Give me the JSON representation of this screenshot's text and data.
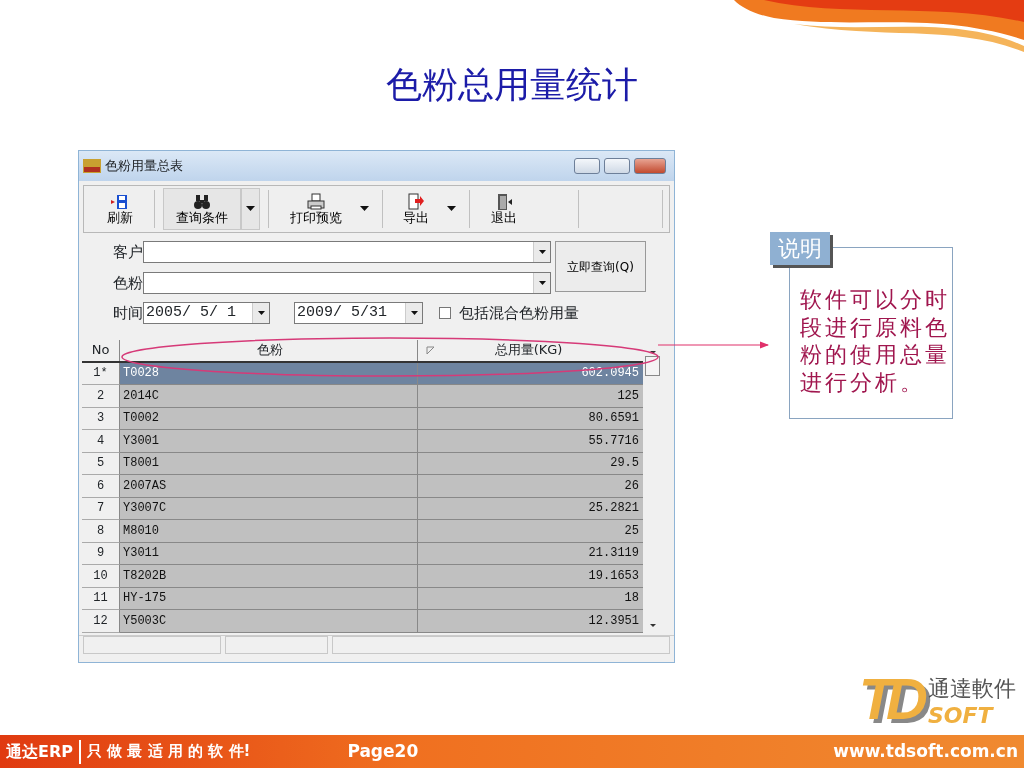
{
  "slide": {
    "title": "色粉总用量统计"
  },
  "window": {
    "title": "色粉用量总表"
  },
  "toolbar": [
    {
      "label": "刷新",
      "kind": "refresh",
      "dropdown": false,
      "pressed": false
    },
    {
      "label": "查询条件",
      "kind": "search",
      "dropdown": true,
      "pressed": true
    },
    {
      "label": "打印预览",
      "kind": "print",
      "dropdown": true,
      "pressed": false
    },
    {
      "label": "导出",
      "kind": "export",
      "dropdown": true,
      "pressed": false
    },
    {
      "label": "退出",
      "kind": "exit",
      "dropdown": false,
      "pressed": false
    }
  ],
  "form": {
    "customer_label": "客户",
    "toner_label": "色粉",
    "time_label": "时间",
    "date_from": "2005/ 5/ 1",
    "date_to": "2009/ 5/31",
    "include_mixed": {
      "label": "包括混合色粉用量",
      "checked": false
    },
    "query_button": "立即查询(Q)"
  },
  "table": {
    "columns": [
      "No",
      "色粉",
      "总用量(KG)"
    ],
    "rows": [
      {
        "no": "1*",
        "toner": "T0028",
        "total": "602.0945",
        "selected": true
      },
      {
        "no": "2",
        "toner": "2014C",
        "total": "125",
        "selected": false
      },
      {
        "no": "3",
        "toner": "T0002",
        "total": "80.6591",
        "selected": false
      },
      {
        "no": "4",
        "toner": "Y3001",
        "total": "55.7716",
        "selected": false
      },
      {
        "no": "5",
        "toner": "T8001",
        "total": "29.5",
        "selected": false
      },
      {
        "no": "6",
        "toner": "2007AS",
        "total": "26",
        "selected": false
      },
      {
        "no": "7",
        "toner": "Y3007C",
        "total": "25.2821",
        "selected": false
      },
      {
        "no": "8",
        "toner": "M8010",
        "total": "25",
        "selected": false
      },
      {
        "no": "9",
        "toner": "Y3011",
        "total": "21.3119",
        "selected": false
      },
      {
        "no": "10",
        "toner": "T8202B",
        "total": "19.1653",
        "selected": false
      },
      {
        "no": "11",
        "toner": "HY-175",
        "total": "18",
        "selected": false
      },
      {
        "no": "12",
        "toner": "Y5003C",
        "total": "12.3951",
        "selected": false
      }
    ]
  },
  "callout": {
    "heading": "说明",
    "text": "软件可以分时段进行原料色粉的使用总量进行分析。"
  },
  "logo": {
    "mark": "TD",
    "name": "通達軟件",
    "sub": "SOFT"
  },
  "footer": {
    "brand": "通达ERP",
    "slogan": "只 做 最 适 用 的 软 件!",
    "page": "Page20",
    "url": "www.tdsoft.com.cn"
  }
}
